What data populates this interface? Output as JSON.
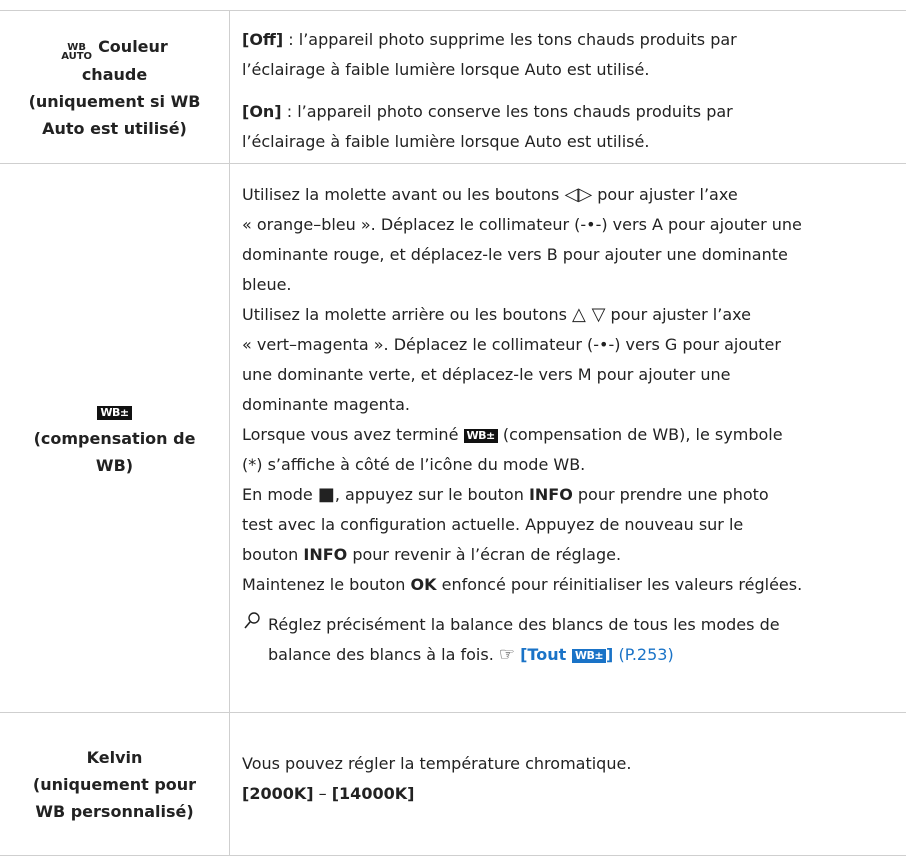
{
  "rows": [
    {
      "left": {
        "icon": "wb-auto-icon",
        "icon_top": "WB",
        "icon_bottom": "AUTO",
        "title_line1": "Couleur",
        "title_line2": "chaude",
        "title_line3": "(uniquement si WB",
        "title_line4": "Auto est utilisé)"
      },
      "right": {
        "off_label": "[Off]",
        "off_text_line1": " : l’appareil photo supprime les tons chauds produits par",
        "off_text_line2": "l’éclairage à faible lumière lorsque Auto est utilisé.",
        "on_label": "[On]",
        "on_text_line1": " : l’appareil photo conserve les tons chauds produits par",
        "on_text_line2": "l’éclairage à faible lumière lorsque Auto est utilisé."
      }
    },
    {
      "left": {
        "icon": "wb-compensation-icon",
        "icon_text": "WB±",
        "title_line1": "(compensation de",
        "title_line2": "WB)"
      },
      "right": {
        "l1a": "Utilisez la molette avant ou les boutons ",
        "lr_arrows": "◁▷",
        "l1b": " pour ajuster l’axe",
        "l2": "« orange–bleu ». Déplacez le collimateur (-•-) vers A pour ajouter une",
        "l3": "dominante rouge, et déplacez-le vers B pour ajouter une dominante",
        "l4": "bleue.",
        "l5a": "Utilisez la molette arrière ou les boutons ",
        "ud_arrows": "△ ▽",
        "l5b": " pour ajuster l’axe",
        "l6": "« vert–magenta ». Déplacez le collimateur (-•-) vers G pour ajouter",
        "l7": "une dominante verte, et déplacez-le vers M pour ajouter une",
        "l8": "dominante magenta.",
        "l9a": "Lorsque vous avez terminé ",
        "l9b": " (compensation de WB), le symbole",
        "l10": "(*) s’affiche à côté de l’icône du mode WB.",
        "l11a": "En mode ",
        "camera_icon": "■",
        "l11b": ", appuyez sur le bouton ",
        "info1": "INFO",
        "l11c": " pour prendre une photo",
        "l12": "test avec la configuration actuelle. Appuyez de nouveau sur le",
        "l13a": "bouton ",
        "info2": "INFO",
        "l13b": " pour revenir à l’écran de réglage.",
        "l14a": "Maintenez le bouton ",
        "ok": "OK",
        "l14b": " enfoncé pour réinitialiser les valeurs réglées.",
        "tip_icon": "tip-icon",
        "tip_line1": "Réglez précisément la balance des blancs de tous les modes de",
        "tip_line2a": "balance des blancs à la fois. ",
        "ref_icon": "☞",
        "tip_link_a": "[Tout ",
        "tip_link_b": "]",
        "tip_page": " (P.253)"
      }
    },
    {
      "left": {
        "title_line1": "Kelvin",
        "title_line2": "(uniquement pour",
        "title_line3": "WB personnalisé)"
      },
      "right": {
        "line1": "Vous pouvez régler la température chromatique.",
        "range_a": "[2000K]",
        "range_sep": " – ",
        "range_b": "[14000K]"
      }
    }
  ]
}
